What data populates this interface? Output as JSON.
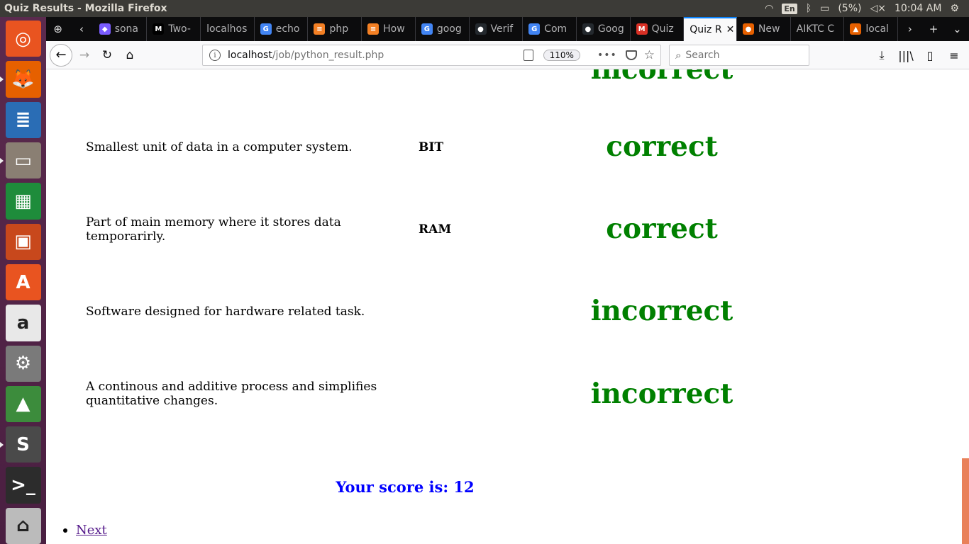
{
  "window": {
    "title": "Quiz Results - Mozilla Firefox",
    "keyboard_layout": "En",
    "battery": "(5%)",
    "clock": "10:04 AM"
  },
  "launcher": {
    "items": [
      {
        "name": "ubuntu-dash-icon",
        "glyph": "◎",
        "bg": "#e95420"
      },
      {
        "name": "firefox-icon",
        "glyph": "🦊",
        "bg": "#e66000"
      },
      {
        "name": "libreoffice-writer-icon",
        "glyph": "≣",
        "bg": "#2a6db5"
      },
      {
        "name": "file-manager-icon",
        "glyph": "▭",
        "bg": "#8a7f73"
      },
      {
        "name": "libreoffice-calc-icon",
        "glyph": "▦",
        "bg": "#1e8c3b"
      },
      {
        "name": "libreoffice-impress-icon",
        "glyph": "▣",
        "bg": "#c8481c"
      },
      {
        "name": "software-center-icon",
        "glyph": "A",
        "bg": "#e95420"
      },
      {
        "name": "amazon-icon",
        "glyph": "a",
        "bg": "#e8e8e8"
      },
      {
        "name": "system-settings-icon",
        "glyph": "⚙",
        "bg": "#7a7a7a"
      },
      {
        "name": "android-studio-icon",
        "glyph": "▲",
        "bg": "#3c8c3c"
      },
      {
        "name": "sublime-text-icon",
        "glyph": "S",
        "bg": "#4a4a4a"
      },
      {
        "name": "terminal-icon",
        "glyph": ">_",
        "bg": "#2c2c2c"
      },
      {
        "name": "trash-icon",
        "glyph": "⌂",
        "bg": "#bbbbbb"
      }
    ]
  },
  "tabs": [
    {
      "label": "sona",
      "favicon": "◆",
      "color": "#7a5cff"
    },
    {
      "label": "Two-",
      "favicon": "M",
      "color": "#000000"
    },
    {
      "label": "localhos",
      "favicon": "",
      "color": "transparent"
    },
    {
      "label": "echo",
      "favicon": "G",
      "color": "#4285f4"
    },
    {
      "label": "php",
      "favicon": "≡",
      "color": "#f48024"
    },
    {
      "label": "How",
      "favicon": "≡",
      "color": "#f48024"
    },
    {
      "label": "goog",
      "favicon": "G",
      "color": "#4285f4"
    },
    {
      "label": "Verif",
      "favicon": "●",
      "color": "#24292e"
    },
    {
      "label": "Com",
      "favicon": "G",
      "color": "#4285f4"
    },
    {
      "label": "Goog",
      "favicon": "●",
      "color": "#24292e"
    },
    {
      "label": "Quiz",
      "favicon": "M",
      "color": "#d93025"
    },
    {
      "label": "Quiz R",
      "favicon": "",
      "color": "transparent",
      "active": true
    },
    {
      "label": "New",
      "favicon": "●",
      "color": "#e66000"
    },
    {
      "label": "AIKTC C",
      "favicon": "",
      "color": "transparent"
    },
    {
      "label": "local",
      "favicon": "▲",
      "color": "#e66000"
    }
  ],
  "navbar": {
    "url_host": "localhost",
    "url_path": "/job/python_result.php",
    "zoom": "110%",
    "search_placeholder": "Search"
  },
  "page": {
    "partial_top_result": "incorrect",
    "rows": [
      {
        "question": "Smallest unit of data in a computer system.",
        "answer": "BIT",
        "result": "correct"
      },
      {
        "question": "Part of main memory where it stores data temporarirly.",
        "answer": "RAM",
        "result": "correct"
      },
      {
        "question": "Software designed for hardware related task.",
        "answer": "",
        "result": "incorrect"
      },
      {
        "question": "A continous and additive process and simplifies quantitative changes.",
        "answer": "",
        "result": "incorrect"
      }
    ],
    "score_text": "Your score is: 12",
    "next_link": "Next"
  }
}
